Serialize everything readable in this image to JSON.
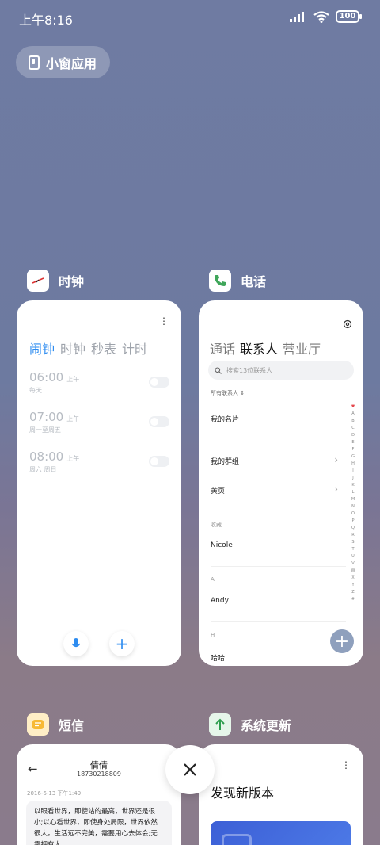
{
  "status_bar": {
    "time": "上午8:16",
    "battery": "100"
  },
  "pill": {
    "label": "小窗应用"
  },
  "apps": {
    "clock": {
      "name": "时钟",
      "tabs": [
        "闹钟",
        "时钟",
        "秒表",
        "计时"
      ],
      "alarms": [
        {
          "time": "06:00",
          "ampm": "上午",
          "repeat": "每天"
        },
        {
          "time": "07:00",
          "ampm": "上午",
          "repeat": "周一至周五"
        },
        {
          "time": "08:00",
          "ampm": "上午",
          "repeat": "周六 周日"
        }
      ]
    },
    "phone": {
      "name": "电话",
      "tabs": [
        "通话",
        "联系人",
        "营业厅"
      ],
      "search_placeholder": "搜索13位联系人",
      "all_contacts": "所有联系人",
      "my_card": "我的名片",
      "my_groups": "我的群组",
      "yellow_pages": "黄页",
      "favorites_header": "收藏",
      "favorite_contact": "Nicole",
      "section_a": "A",
      "contact_a": "Andy",
      "section_h": "H",
      "contact_h": "哈哈",
      "alphabet": [
        "♥",
        "A",
        "B",
        "C",
        "D",
        "E",
        "F",
        "G",
        "H",
        "I",
        "J",
        "K",
        "L",
        "M",
        "N",
        "O",
        "P",
        "Q",
        "R",
        "S",
        "T",
        "U",
        "V",
        "W",
        "X",
        "Y",
        "Z",
        "#"
      ]
    },
    "sms": {
      "name": "短信",
      "contact_name": "倩倩",
      "contact_number": "18730218809",
      "timestamp": "2016-6-13 下午1:49",
      "message": "以眼看世界，即使站的最高，世界还是很小;以心看世界，即使身处局限，世界依然很大。生活远不完美，需要用心去体会;无需拥有太"
    },
    "update": {
      "name": "系统更新",
      "headline": "发现新版本"
    }
  },
  "colors": {
    "accent": "#2d8cf0",
    "fab": "#8fa0bd"
  }
}
